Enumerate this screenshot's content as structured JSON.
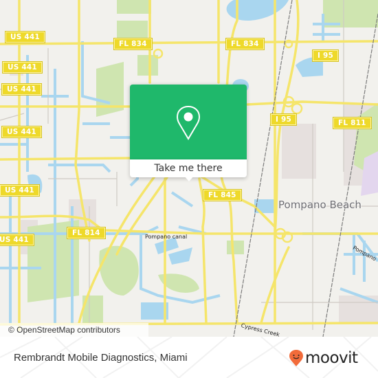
{
  "map": {
    "colors": {
      "land": "#f2f1ed",
      "water": "#a9d6ef",
      "park": "#cfe5b0",
      "urban": "#e6e0de",
      "major_road": "#f5e56a",
      "minor_road": "#cfcac4",
      "rail": "#7b7b7b",
      "shield_fill": "#eed92a"
    },
    "shields": [
      {
        "label": "US 441"
      },
      {
        "label": "US 441"
      },
      {
        "label": "US 441"
      },
      {
        "label": "US 441"
      },
      {
        "label": "US 441"
      },
      {
        "label": "US 441"
      },
      {
        "label": "FL 834"
      },
      {
        "label": "FL 834"
      },
      {
        "label": "I 95"
      },
      {
        "label": "I 95"
      },
      {
        "label": "FL 811"
      },
      {
        "label": "FL 845"
      },
      {
        "label": "FL 814"
      }
    ],
    "city_label": "Pompano Beach",
    "street_labels": {
      "pompano_canal": "Pompano canal",
      "pompano_east": "Pompano",
      "cypress_creek": "Cypress Creek"
    },
    "attribution": "© OpenStreetMap contributors"
  },
  "popup": {
    "icon": "map-pin-icon",
    "button_label": "Take me there",
    "accent_color": "#1fb86b"
  },
  "footer": {
    "place_title": "Rembrandt Mobile Diagnostics, Miami",
    "brand": {
      "name": "moovit",
      "logo_icon": "moovit-pin-icon",
      "logo_color": "#f26b3a"
    }
  }
}
